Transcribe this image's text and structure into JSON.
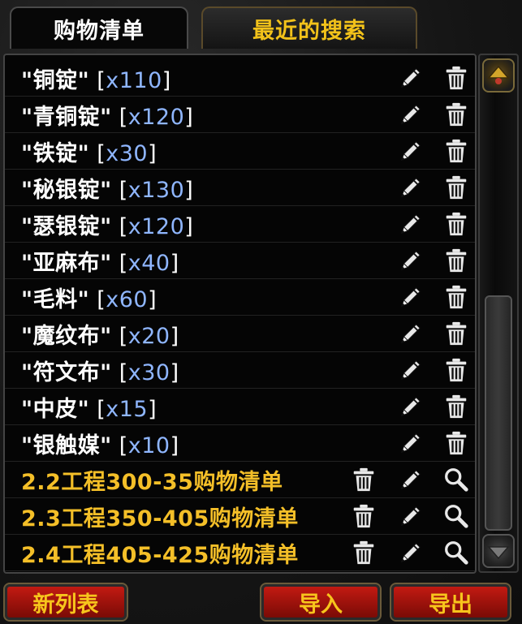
{
  "tabs": {
    "shopping_list": "购物清单",
    "recent_searches": "最近的搜索"
  },
  "items": [
    {
      "name": "\"铜锭\"",
      "qty": "x110"
    },
    {
      "name": "\"青铜锭\"",
      "qty": "x120"
    },
    {
      "name": "\"铁锭\"",
      "qty": "x30"
    },
    {
      "name": "\"秘银锭\"",
      "qty": "x130"
    },
    {
      "name": "\"瑟银锭\"",
      "qty": "x120"
    },
    {
      "name": "\"亚麻布\"",
      "qty": "x40"
    },
    {
      "name": "\"毛料\"",
      "qty": "x60"
    },
    {
      "name": "\"魔纹布\"",
      "qty": "x20"
    },
    {
      "name": "\"符文布\"",
      "qty": "x30"
    },
    {
      "name": "\"中皮\"",
      "qty": "x15"
    },
    {
      "name": "\"银触媒\"",
      "qty": "x10"
    }
  ],
  "lists": [
    {
      "name": "2.2工程300-35购物清单"
    },
    {
      "name": "2.3工程350-405购物清单"
    },
    {
      "name": "2.4工程405-425购物清单"
    }
  ],
  "buttons": {
    "new_list": "新列表",
    "import": "导入",
    "export": "导出"
  },
  "icons": {
    "edit": "pencil-icon",
    "delete": "trash-icon",
    "search": "magnifier-icon",
    "scroll_up": "scroll-up-icon",
    "scroll_down": "scroll-down-icon"
  },
  "colors": {
    "item_text": "#ffffff",
    "qty_text": "#8fb6ff",
    "list_text": "#f4bf28",
    "tab_inactive_text": "#f2c21a",
    "button_bg": "#a8140d",
    "button_text": "#f7c51c"
  }
}
